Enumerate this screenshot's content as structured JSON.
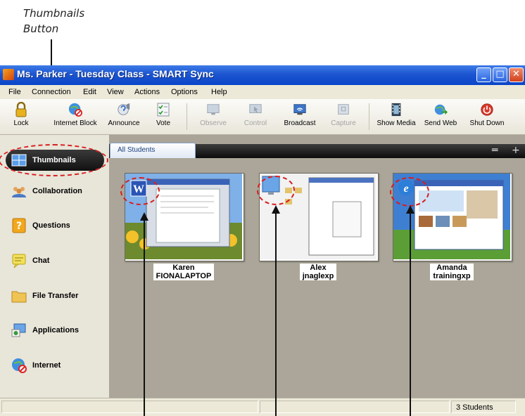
{
  "callout": {
    "line1": "Thumbnails",
    "line2": "Button"
  },
  "window": {
    "title": "Ms. Parker - Tuesday Class - SMART Sync",
    "controls": {
      "minimize": "_",
      "maximize": "□",
      "close": "✕"
    }
  },
  "menu": [
    "File",
    "Connection",
    "Edit",
    "View",
    "Actions",
    "Options",
    "Help"
  ],
  "toolbar": [
    {
      "label": "Lock",
      "icon": "lock-icon",
      "enabled": true
    },
    {
      "label": "Internet Block",
      "icon": "internet-block-icon",
      "enabled": true
    },
    {
      "label": "Announce",
      "icon": "announce-icon",
      "enabled": true
    },
    {
      "label": "Vote",
      "icon": "vote-icon",
      "enabled": true
    },
    {
      "label": "Observe",
      "icon": "observe-icon",
      "enabled": false
    },
    {
      "label": "Control",
      "icon": "control-icon",
      "enabled": false
    },
    {
      "label": "Broadcast",
      "icon": "broadcast-icon",
      "enabled": true
    },
    {
      "label": "Capture",
      "icon": "capture-icon",
      "enabled": false
    },
    {
      "label": "Show Media",
      "icon": "show-media-icon",
      "enabled": true
    },
    {
      "label": "Send Web",
      "icon": "send-web-icon",
      "enabled": true
    },
    {
      "label": "Shut Down",
      "icon": "shut-down-icon",
      "enabled": true
    }
  ],
  "sidebar": [
    {
      "label": "Thumbnails",
      "icon": "thumbnails-icon",
      "active": true
    },
    {
      "label": "Collaboration",
      "icon": "collaboration-icon",
      "active": false
    },
    {
      "label": "Questions",
      "icon": "questions-icon",
      "active": false
    },
    {
      "label": "Chat",
      "icon": "chat-icon",
      "active": false
    },
    {
      "label": "File Transfer",
      "icon": "file-transfer-icon",
      "active": false
    },
    {
      "label": "Applications",
      "icon": "applications-icon",
      "active": false
    },
    {
      "label": "Internet",
      "icon": "internet-icon",
      "active": false
    }
  ],
  "tab": {
    "label": "All Students",
    "collapse": "═",
    "add": "+"
  },
  "students": [
    {
      "name": "Karen",
      "computer": "FIONALAPTOP",
      "app_icon": "word-icon"
    },
    {
      "name": "Alex",
      "computer": "jnaglexp",
      "app_icon": "my-computer-icon"
    },
    {
      "name": "Amanda",
      "computer": "trainingxp",
      "app_icon": "internet-explorer-icon"
    }
  ],
  "status": {
    "count": "3 Students"
  },
  "colors": {
    "titlebar": "#1d55d0",
    "highlight": "#d81e1e",
    "content_bg": "#aba699"
  }
}
